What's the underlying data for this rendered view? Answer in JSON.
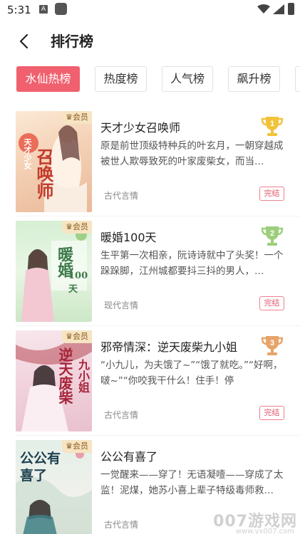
{
  "status_bar": {
    "time": "5:31",
    "notification_icon": "A"
  },
  "header": {
    "title": "排行榜",
    "back_icon": "chevron-left-icon"
  },
  "tabs": [
    {
      "label": "水仙热榜",
      "active": true
    },
    {
      "label": "热度榜",
      "active": false
    },
    {
      "label": "人气榜",
      "active": false
    },
    {
      "label": "飙升榜",
      "active": false
    }
  ],
  "books": [
    {
      "rank": "1",
      "title": "天才少女召唤师",
      "description": "原是前世顶级特种兵的叶玄月，一朝穿越成被世人欺辱致死的叶家废柴女，而当…",
      "category": "古代言情",
      "status": "完结",
      "vip_label": "会员",
      "cover_text": "召唤师",
      "cover_sub": "天才少女",
      "trophy_color": "#f2c23a"
    },
    {
      "rank": "2",
      "title": "暖婚100天",
      "description": "生平第一次相亲，阮诗诗就中了头奖！一个跺跺脚，江州城都要抖三抖的男人，…",
      "category": "现代言情",
      "status": "完结",
      "vip_label": "会员",
      "cover_text": "暖婚",
      "cover_sub": "100天",
      "trophy_color": "#9ccf7c"
    },
    {
      "rank": "3",
      "title": "邪帝情深：逆天废柴九小姐",
      "description": "“小九儿，为夫饿了~”“饿了就吃。”“好啊，啵~”“你咬我干什么！住手！停下……”某…",
      "category": "古代言情",
      "status": "完结",
      "vip_label": "会员",
      "cover_text": "逆天废柴",
      "cover_sub": "九小姐",
      "trophy_color": "#e7a46a"
    },
    {
      "rank": "",
      "title": "公公有喜了",
      "description": "一觉醒来——穿了！无语凝噎——穿成了太监！泥煤，她苏小喜上辈子特级毒师救…",
      "category": "古代言情",
      "status": "",
      "vip_label": "会员",
      "cover_text": "公公有喜了",
      "cover_sub": "",
      "trophy_color": ""
    }
  ],
  "watermark": {
    "main": "007游戏网",
    "sub": "www.yx007.com"
  }
}
